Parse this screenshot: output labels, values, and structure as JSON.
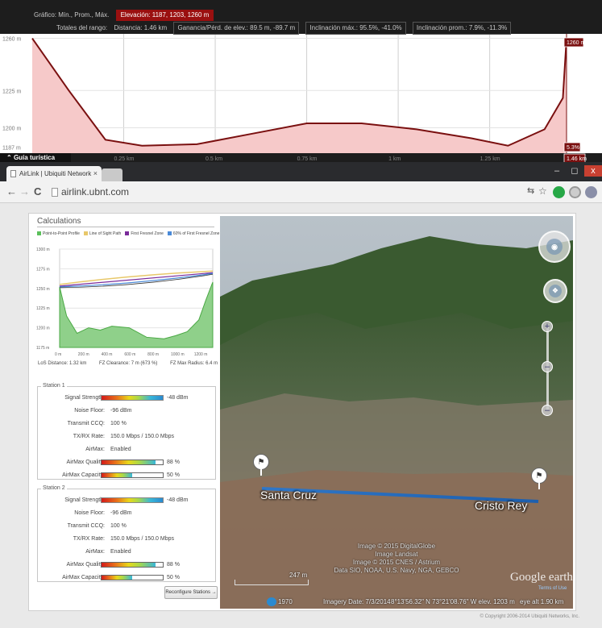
{
  "elevation": {
    "header": {
      "grafico_label": "Gráfico: Mín., Prom., Máx.",
      "elevacion": "Elevación: 1187, 1203, 1260 m",
      "totales_label": "Totales del rango:",
      "distancia": "Distancia: 1.46 km",
      "ganancia": "Ganancia/Pérd. de elev.: 89.5 m, -89.7 m",
      "inclinacion_max": "Inclinación máx.: 95.5%, -41.0%",
      "inclinacion_prom": "Inclinación prom.: 7.9%, -11.3%"
    },
    "y_labels": [
      "1260 m",
      "1225 m",
      "1200 m",
      "1187 m"
    ],
    "x_labels": [
      "0.25 km",
      "0.5 km",
      "0.75 km",
      "1 km",
      "1.25 km"
    ],
    "right_top_tag": "1260 m",
    "right_slope_tag": "5.3%",
    "right_dist_tag": "1.46 km",
    "guia_label": "Guía turística",
    "chart_data": {
      "type": "area",
      "x": [
        0,
        0.1,
        0.2,
        0.3,
        0.45,
        0.6,
        0.75,
        0.9,
        1.05,
        1.2,
        1.3,
        1.4,
        1.45,
        1.46
      ],
      "y": [
        1260,
        1225,
        1192,
        1188,
        1189,
        1196,
        1203,
        1203,
        1199,
        1193,
        1188,
        1199,
        1220,
        1260
      ],
      "xlim": [
        0,
        1.46
      ],
      "ylim": [
        1183,
        1263
      ],
      "line_color": "#7a1010",
      "fill_color": "#f6c9c9"
    }
  },
  "browser": {
    "tab_title": "AirLink | Ubiquiti Network",
    "tab_close": "×",
    "url": "airlink.ubnt.com",
    "back": "←",
    "forward": "→",
    "reload": "C",
    "minimize": "–",
    "maximize": "◻",
    "close": "x"
  },
  "airlink": {
    "calc_title": "Calculations",
    "legend": [
      {
        "label": "Point-to-Point Profile",
        "color": "#5cc05c"
      },
      {
        "label": "Line of Sight Path",
        "color": "#e8c86a"
      },
      {
        "label": "First Fresnel Zone",
        "color": "#7a2b9a"
      },
      {
        "label": "60% of First Fresnel Zone",
        "color": "#4a8ad8"
      }
    ],
    "profile_chart": {
      "y_labels": [
        "1300 m",
        "1275 m",
        "1250 m",
        "1225 m",
        "1200 m",
        "1175 m"
      ],
      "x_labels": [
        "0 m",
        "200 m",
        "400 m",
        "600 m",
        "800 m",
        "1000 m",
        "1200 m"
      ]
    },
    "los_stats": {
      "distance": "LoS Distance: 1.32 km",
      "clearance": "FZ Clearance: 7 m (673 %)",
      "radius": "FZ Max Radius: 6.4 m"
    },
    "stations": [
      {
        "title": "Station 1",
        "signal_label": "Signal Strength:",
        "signal_value": "-48 dBm",
        "noise_label": "Noise Floor:",
        "noise_value": "-96 dBm",
        "ccq_label": "Transmit CCQ:",
        "ccq_value": "100 %",
        "rate_label": "TX/RX Rate:",
        "rate_value": "150.0 Mbps / 150.0 Mbps",
        "airmax_label": "AirMax:",
        "airmax_value": "Enabled",
        "quality_label": "AirMax Quality:",
        "quality_value": "88 %",
        "quality_level": 0.88,
        "capacity_label": "AirMax Capacity:",
        "capacity_value": "50 %",
        "capacity_level": 0.5
      },
      {
        "title": "Station 2",
        "signal_label": "Signal Strength:",
        "signal_value": "-48 dBm",
        "noise_label": "Noise Floor:",
        "noise_value": "-96 dBm",
        "ccq_label": "Transmit CCQ:",
        "ccq_value": "100 %",
        "rate_label": "TX/RX Rate:",
        "rate_value": "150.0 Mbps / 150.0 Mbps",
        "airmax_label": "AirMax:",
        "airmax_value": "Enabled",
        "quality_label": "AirMax Quality:",
        "quality_value": "88 %",
        "quality_level": 0.88,
        "capacity_label": "AirMax Capacity:",
        "capacity_value": "50 %",
        "capacity_level": 0.5
      }
    ],
    "reconfigure_button": "Reconfigure Stations →",
    "copyright": "© Copyright 2006-2014 Ubiquiti Networks, Inc."
  },
  "map": {
    "place_a": "Santa Cruz",
    "place_b": "Cristo Rey",
    "credits": [
      "Image © 2015 DigitalGlobe",
      "Image Landsat",
      "Image © 2015 CNES / Astrium",
      "Data SIO, NOAA, U.S. Navy, NGA, GEBCO"
    ],
    "scale": "247 m",
    "year": "1970",
    "imagery_date": "Imagery Date: 7/3/2014",
    "coords": "8°13'56.32\" N   73°21'08.76\" W  elev. 1203 m",
    "eye_alt": "eye alt  1.90 km",
    "logo": "Google earth",
    "terms": "Terms of Use"
  }
}
